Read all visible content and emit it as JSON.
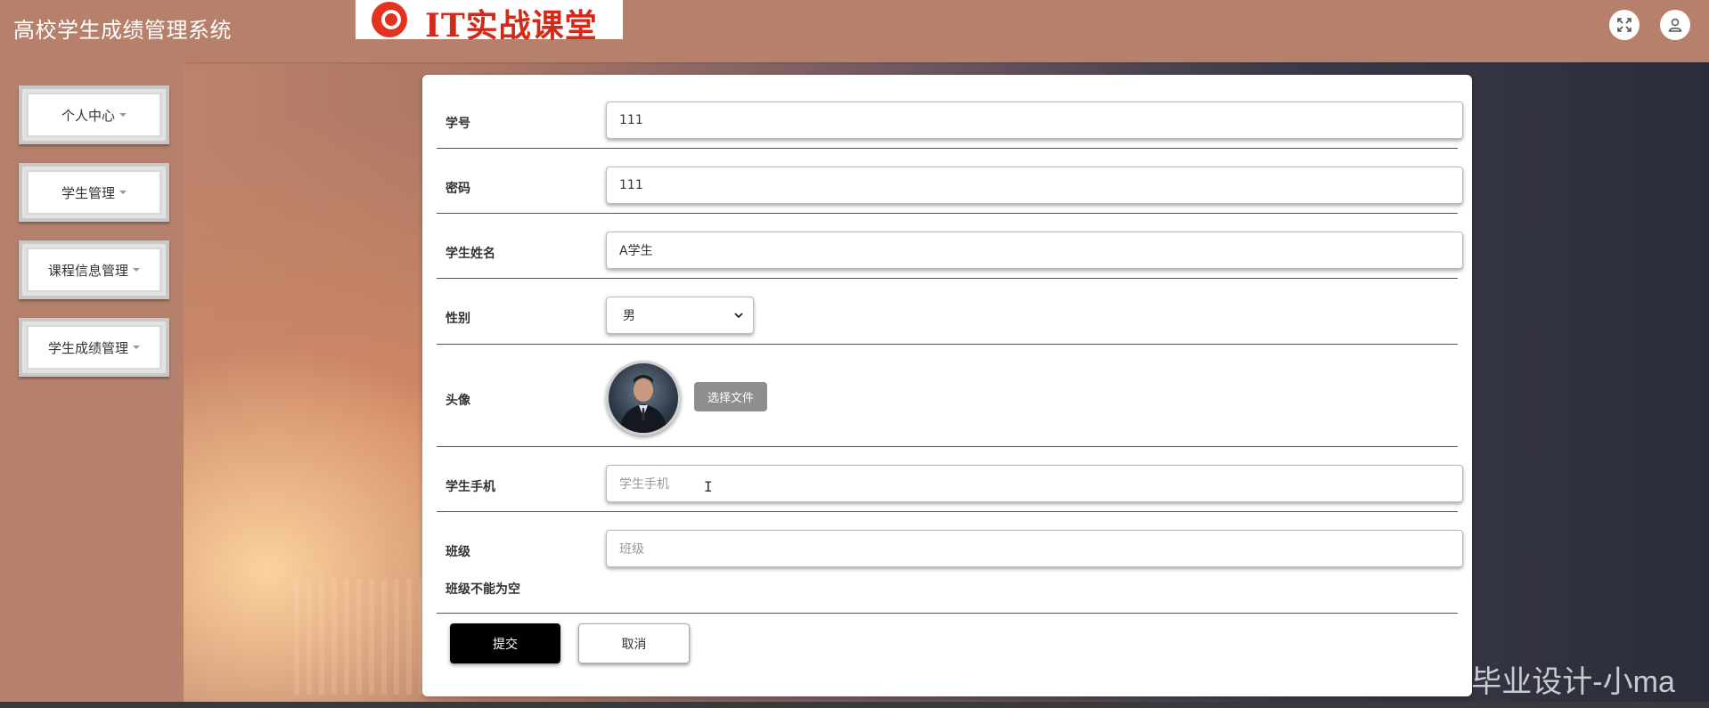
{
  "header": {
    "app_title": "高校学生成绩管理系统",
    "logo_text": "IT实战课堂"
  },
  "icons": {
    "expand": "expand-icon",
    "user": "user-icon",
    "logo": "chrome-like-logo-icon"
  },
  "sidebar": {
    "items": [
      {
        "label": "个人中心"
      },
      {
        "label": "学生管理"
      },
      {
        "label": "课程信息管理"
      },
      {
        "label": "学生成绩管理"
      }
    ]
  },
  "form": {
    "student_id": {
      "label": "学号",
      "value": "111"
    },
    "password": {
      "label": "密码",
      "value": "111"
    },
    "student_name": {
      "label": "学生姓名",
      "value": "A学生"
    },
    "gender": {
      "label": "性别",
      "value": "男"
    },
    "avatar": {
      "label": "头像",
      "file_button": "选择文件"
    },
    "phone": {
      "label": "学生手机",
      "placeholder": "学生手机"
    },
    "class": {
      "label": "班级",
      "placeholder": "班级",
      "error": "班级不能为空"
    },
    "submit_label": "提交",
    "cancel_label": "取消"
  },
  "watermark": "CSDN @计算机毕业设计-小ma",
  "colors": {
    "header_bg": "#b6806b",
    "sidebar_bg": "#b5806c",
    "submit_bg": "#000000",
    "file_button_bg": "#8e8e8e"
  }
}
